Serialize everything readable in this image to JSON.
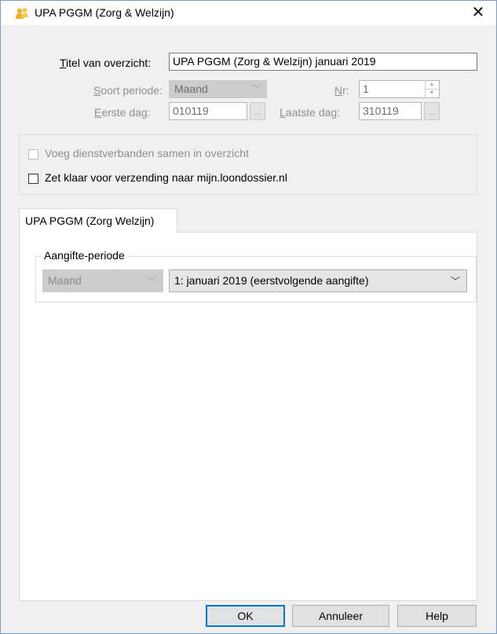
{
  "window": {
    "title": "UPA PGGM (Zorg & Welzijn)",
    "close_symbol": "✕",
    "icon": "people-icon"
  },
  "form": {
    "titel_label_u": "T",
    "titel_label_rest": "itel van overzicht:",
    "titel_value": "UPA PGGM (Zorg & Welzijn) januari 2019",
    "soort_label_u": "S",
    "soort_label_rest": "oort periode:",
    "soort_value": "Maand",
    "nr_label_u": "N",
    "nr_label_rest": "r:",
    "nr_value": "1",
    "eerste_label_u": "E",
    "eerste_label_rest": "erste dag:",
    "eerste_value": "010119",
    "laatste_label_u": "L",
    "laatste_label_rest": "aatste dag:",
    "laatste_value": "310119",
    "ellipsis": "..."
  },
  "options": {
    "samenvoegen_label": "Voeg dienstverbanden samen in overzicht",
    "samenvoegen_checked": false,
    "samenvoegen_enabled": false,
    "verzending_label": "Zet klaar voor verzending naar mijn.loondossier.nl",
    "verzending_checked": false
  },
  "tabs": [
    {
      "label": "UPA PGGM (Zorg  Welzijn)",
      "active": true
    }
  ],
  "aangifte": {
    "legend": "Aangifte-periode",
    "period_type": "Maand",
    "period_value": "1: januari 2019 (eerstvolgende aangifte)"
  },
  "buttons": {
    "ok": "OK",
    "cancel": "Annuleer",
    "help": "Help"
  },
  "colors": {
    "default_button_border": "#0078d7",
    "window_bg": "#f0f0f0",
    "disabled_text": "#8f8f8f"
  }
}
